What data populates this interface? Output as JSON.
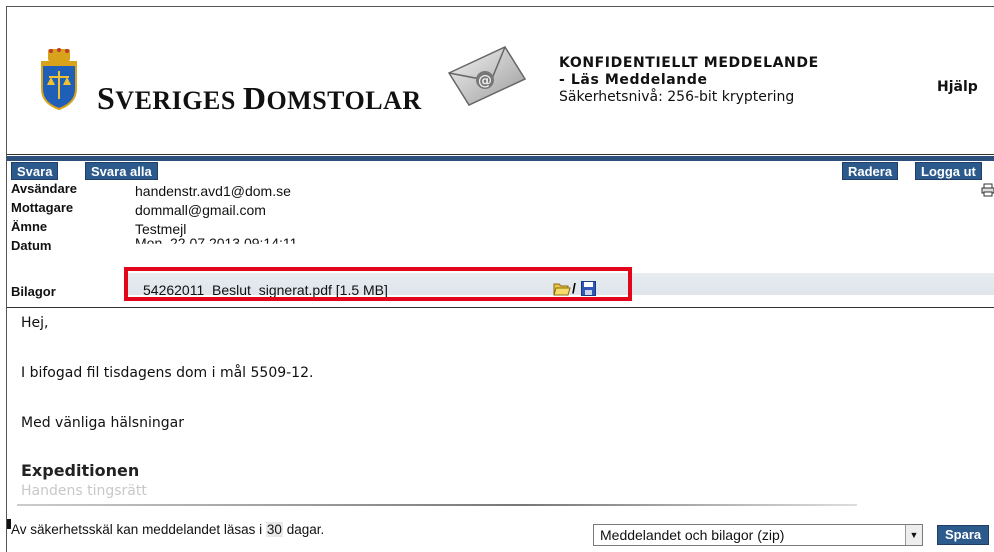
{
  "header": {
    "logo_text_part1_cap": "S",
    "logo_text_part1": "VERIGES ",
    "logo_text_part2_cap": "D",
    "logo_text_part2": "OMSTOLAR",
    "notice_title": "KONFIDENTIELLT MEDDELANDE",
    "notice_subtitle": "- Läs Meddelande",
    "notice_security": "Säkerhetsnivå: 256-bit kryptering",
    "help_label": "Hjälp"
  },
  "toolbar": {
    "reply_label": "Svara",
    "reply_all_label": "Svara alla",
    "delete_label": "Radera",
    "logout_label": "Logga ut"
  },
  "meta": {
    "sender_label": "Avsändare",
    "sender_value": "handenstr.avd1@dom.se",
    "recipient_label": "Mottagare",
    "recipient_value": "dommall@gmail.com",
    "subject_label": "Ämne",
    "subject_value": "Testmejl",
    "date_label": "Datum",
    "date_value": "Mon, 22.07.2013 09:14:11",
    "attachments_label": "Bilagor",
    "attachment_name": "54262011_Beslut_signerat.pdf [1.5 MB]",
    "attachment_separator": "/"
  },
  "message": {
    "greeting": "Hej,",
    "line1": "I bifogad fil tisdagens dom i mål 5509-12.",
    "closing": "Med vänliga hälsningar",
    "signature": "Expeditionen",
    "court": "Handens tingsrätt"
  },
  "footer": {
    "notice_prefix": "Av säkerhetsskäl kan meddelandet läsas i ",
    "days": "30",
    "notice_suffix": " dagar.",
    "download_option": "Meddelandet och bilagor (zip)",
    "save_label": "Spara"
  },
  "colors": {
    "button_blue": "#2c5a8c",
    "highlight_red": "#e2061b"
  }
}
